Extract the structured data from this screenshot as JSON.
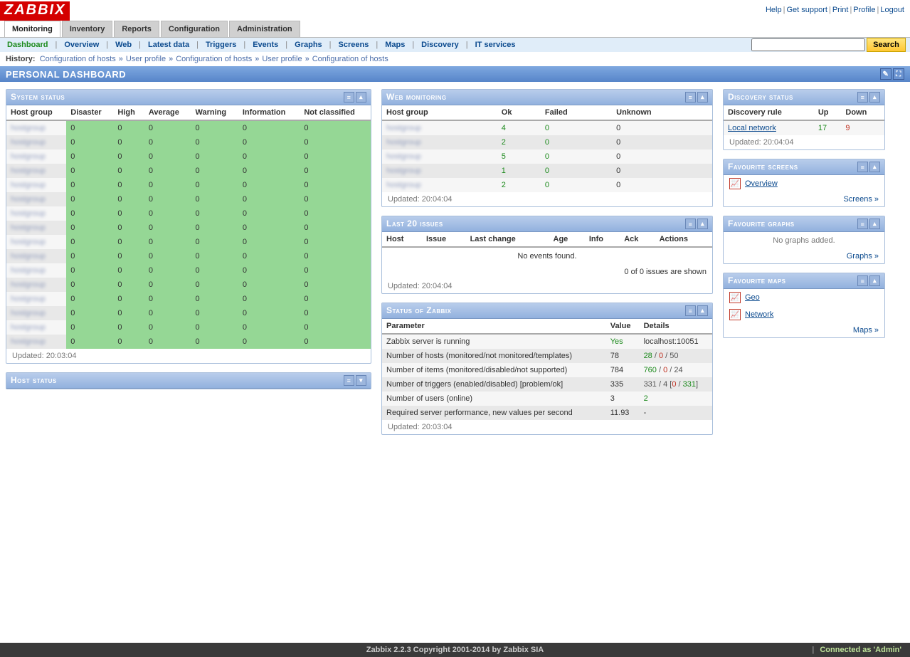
{
  "logo": "ZABBIX",
  "top_links": [
    "Help",
    "Get support",
    "Print",
    "Profile",
    "Logout"
  ],
  "tabs": [
    "Monitoring",
    "Inventory",
    "Reports",
    "Configuration",
    "Administration"
  ],
  "active_tab": "Monitoring",
  "submenu": [
    "Dashboard",
    "Overview",
    "Web",
    "Latest data",
    "Triggers",
    "Events",
    "Graphs",
    "Screens",
    "Maps",
    "Discovery",
    "IT services"
  ],
  "active_submenu": "Dashboard",
  "search_button": "Search",
  "history_label": "History:",
  "history": [
    "Configuration of hosts",
    "User profile",
    "Configuration of hosts",
    "User profile",
    "Configuration of hosts"
  ],
  "page_title": "PERSONAL DASHBOARD",
  "system_status": {
    "title": "System status",
    "headers": [
      "Host group",
      "Disaster",
      "High",
      "Average",
      "Warning",
      "Information",
      "Not classified"
    ],
    "rows": [
      [
        "",
        0,
        0,
        0,
        0,
        0,
        0
      ],
      [
        "",
        0,
        0,
        0,
        0,
        0,
        0
      ],
      [
        "",
        0,
        0,
        0,
        0,
        0,
        0
      ],
      [
        "",
        0,
        0,
        0,
        0,
        0,
        0
      ],
      [
        "",
        0,
        0,
        0,
        0,
        0,
        0
      ],
      [
        "",
        0,
        0,
        0,
        0,
        0,
        0
      ],
      [
        "",
        0,
        0,
        0,
        0,
        0,
        0
      ],
      [
        "",
        0,
        0,
        0,
        0,
        0,
        0
      ],
      [
        "",
        0,
        0,
        0,
        0,
        0,
        0
      ],
      [
        "",
        0,
        0,
        0,
        0,
        0,
        0
      ],
      [
        "",
        0,
        0,
        0,
        0,
        0,
        0
      ],
      [
        "",
        0,
        0,
        0,
        0,
        0,
        0
      ],
      [
        "",
        0,
        0,
        0,
        0,
        0,
        0
      ],
      [
        "",
        0,
        0,
        0,
        0,
        0,
        0
      ],
      [
        "",
        0,
        0,
        0,
        0,
        0,
        0
      ],
      [
        "",
        0,
        0,
        0,
        0,
        0,
        0
      ]
    ],
    "updated": "Updated: 20:03:04"
  },
  "host_status": {
    "title": "Host status"
  },
  "web_monitoring": {
    "title": "Web monitoring",
    "headers": [
      "Host group",
      "Ok",
      "Failed",
      "Unknown"
    ],
    "rows": [
      [
        "",
        "4",
        "0",
        "0"
      ],
      [
        "",
        "2",
        "0",
        "0"
      ],
      [
        "",
        "5",
        "0",
        "0"
      ],
      [
        "",
        "1",
        "0",
        "0"
      ],
      [
        "",
        "2",
        "0",
        "0"
      ]
    ],
    "updated": "Updated: 20:04:04"
  },
  "last_issues": {
    "title": "Last 20 issues",
    "headers": [
      "Host",
      "Issue",
      "Last change",
      "Age",
      "Info",
      "Ack",
      "Actions"
    ],
    "empty": "No events found.",
    "shown": "0 of 0 issues are shown",
    "updated": "Updated: 20:04:04"
  },
  "status_zabbix": {
    "title": "Status of Zabbix",
    "headers": [
      "Parameter",
      "Value",
      "Details"
    ],
    "rows": [
      {
        "param": "Zabbix server is running",
        "value": "Yes",
        "value_class": "green",
        "details": "localhost:10051"
      },
      {
        "param": "Number of hosts (monitored/not monitored/templates)",
        "value": "78",
        "details_parts": [
          {
            "t": "28",
            "c": "green"
          },
          {
            "t": " / ",
            "c": "grey"
          },
          {
            "t": "0",
            "c": "red"
          },
          {
            "t": " / 50",
            "c": "grey"
          }
        ]
      },
      {
        "param": "Number of items (monitored/disabled/not supported)",
        "value": "784",
        "details_parts": [
          {
            "t": "760",
            "c": "green"
          },
          {
            "t": " / ",
            "c": "grey"
          },
          {
            "t": "0",
            "c": "red"
          },
          {
            "t": " / 24",
            "c": "grey"
          }
        ]
      },
      {
        "param": "Number of triggers (enabled/disabled) [problem/ok]",
        "value": "335",
        "details_parts": [
          {
            "t": "331 / 4 [",
            "c": "grey"
          },
          {
            "t": "0",
            "c": "red"
          },
          {
            "t": " / ",
            "c": "grey"
          },
          {
            "t": "331",
            "c": "green"
          },
          {
            "t": "]",
            "c": "grey"
          }
        ]
      },
      {
        "param": "Number of users (online)",
        "value": "3",
        "details_parts": [
          {
            "t": "2",
            "c": "green"
          }
        ]
      },
      {
        "param": "Required server performance, new values per second",
        "value": "11.93",
        "details": "-"
      }
    ],
    "updated": "Updated: 20:03:04"
  },
  "discovery": {
    "title": "Discovery status",
    "headers": [
      "Discovery rule",
      "Up",
      "Down"
    ],
    "rows": [
      {
        "rule": "Local network",
        "up": "17",
        "down": "9"
      }
    ],
    "updated": "Updated: 20:04:04"
  },
  "fav_screens": {
    "title": "Favourite screens",
    "items": [
      "Overview"
    ],
    "link": "Screens »"
  },
  "fav_graphs": {
    "title": "Favourite graphs",
    "empty": "No graphs added.",
    "link": "Graphs »"
  },
  "fav_maps": {
    "title": "Favourite maps",
    "items": [
      "Geo",
      "Network"
    ],
    "link": "Maps »"
  },
  "footer": {
    "copyright": "Zabbix 2.2.3 Copyright 2001-2014 by Zabbix SIA",
    "connected": "Connected as 'Admin'"
  }
}
